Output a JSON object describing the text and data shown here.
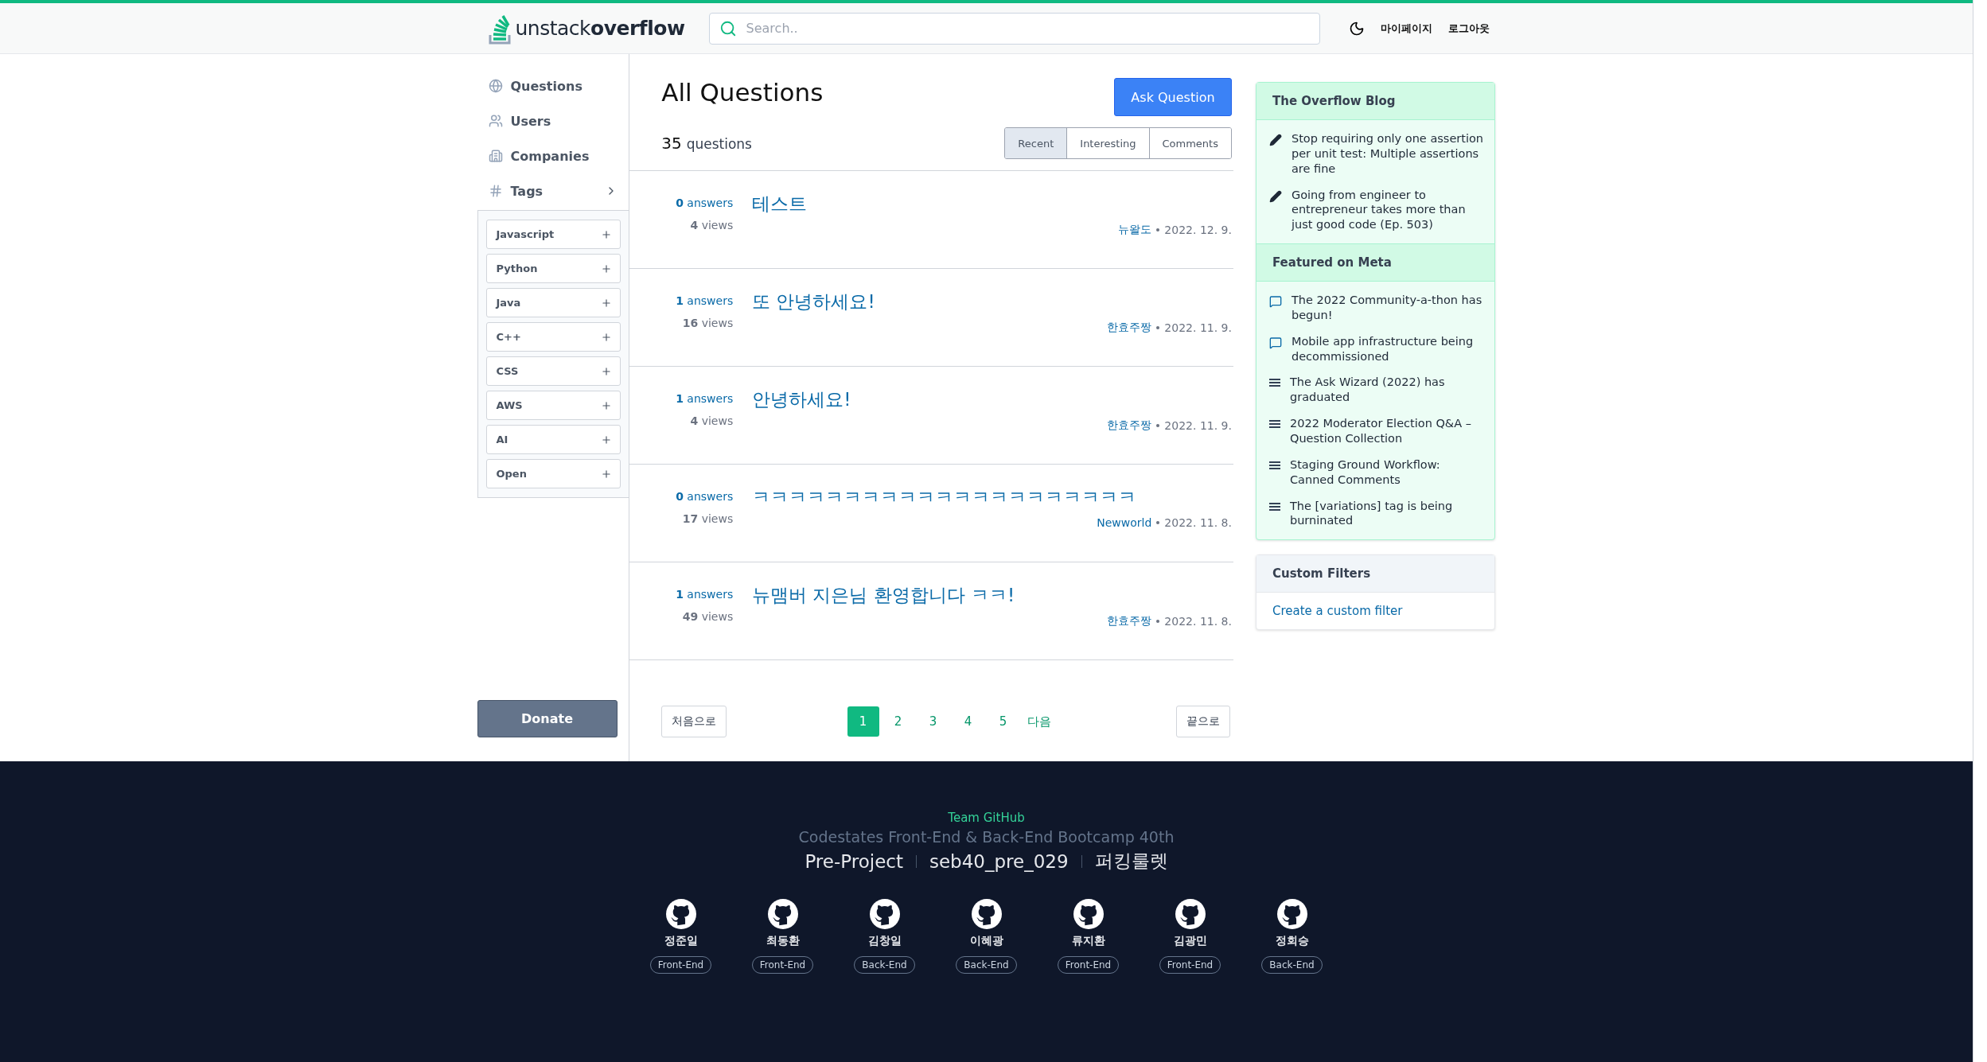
{
  "header": {
    "logo_light": "unstack",
    "logo_bold": "overflow",
    "search": {
      "placeholder": "Search.."
    },
    "links": [
      "마이페이지",
      "로그아웃"
    ]
  },
  "sidebar": {
    "items": [
      {
        "label": "Questions"
      },
      {
        "label": "Users"
      },
      {
        "label": "Companies"
      },
      {
        "label": "Tags",
        "children": [
          {
            "label": "Javascript"
          },
          {
            "label": "Python"
          },
          {
            "label": "Java"
          },
          {
            "label": "C++"
          },
          {
            "label": "CSS"
          },
          {
            "label": "AWS"
          },
          {
            "label": "AI"
          },
          {
            "label": "Open"
          }
        ]
      }
    ],
    "donate": "Donate"
  },
  "main": {
    "title": "All Questions",
    "ask_button": "Ask Question",
    "count": "35",
    "count_label": "questions",
    "tabs": [
      {
        "label": "Recent",
        "selected": true
      },
      {
        "label": "Interesting",
        "selected": false
      },
      {
        "label": "Comments",
        "selected": false
      }
    ],
    "questions": [
      {
        "answers": "0",
        "answers_label": "answers",
        "views": "4",
        "views_label": "views",
        "title": "테스트",
        "author": "뉴왈도",
        "date": "2022. 12. 9."
      },
      {
        "answers": "1",
        "answers_label": "answers",
        "views": "16",
        "views_label": "views",
        "title": "또 안녕하세요!",
        "author": "한효주짱",
        "date": "2022. 11. 9."
      },
      {
        "answers": "1",
        "answers_label": "answers",
        "views": "4",
        "views_label": "views",
        "title": "안녕하세요!",
        "author": "한효주짱",
        "date": "2022. 11. 9."
      },
      {
        "answers": "0",
        "answers_label": "answers",
        "views": "17",
        "views_label": "views",
        "title": "ㅋㅋㅋㅋㅋㅋㅋㅋㅋㅋㅋㅋㅋㅋㅋㅋㅋㅋㅋㅋㅋ",
        "author": "Newworld",
        "date": "2022. 11. 8."
      },
      {
        "answers": "1",
        "answers_label": "answers",
        "views": "49",
        "views_label": "views",
        "title": "뉴맴버 지은님 환영합니다 ㅋㅋ!",
        "author": "한효주짱",
        "date": "2022. 11. 8."
      }
    ],
    "pagination": {
      "first": "처음으로",
      "pages": [
        {
          "label": "1",
          "selected": true
        },
        {
          "label": "2",
          "selected": false
        },
        {
          "label": "3",
          "selected": false
        },
        {
          "label": "4",
          "selected": false
        },
        {
          "label": "5",
          "selected": false
        }
      ],
      "next": "다음",
      "last": "끝으로"
    }
  },
  "aside": {
    "blog": {
      "title": "The Overflow Blog",
      "items": [
        {
          "kind": "pencil",
          "text": "Stop requiring only one assertion per unit test: Multiple assertions are fine"
        },
        {
          "kind": "pencil",
          "text": "Going from engineer to entrepreneur takes more than just good code (Ep. 503)"
        }
      ]
    },
    "meta": {
      "title": "Featured on Meta",
      "items": [
        {
          "kind": "chat",
          "text": "The 2022 Community-a-thon has begun!"
        },
        {
          "kind": "chat",
          "text": "Mobile app infrastructure being decommissioned"
        },
        {
          "kind": "lines",
          "text": "The Ask Wizard (2022) has graduated"
        },
        {
          "kind": "lines",
          "text": "2022 Moderator Election Q&A – Question Collection"
        },
        {
          "kind": "lines",
          "text": "Staging Ground Workflow: Canned Comments"
        },
        {
          "kind": "lines",
          "text": "The [variations] tag is being burninated"
        }
      ]
    },
    "filters": {
      "title": "Custom Filters",
      "link": "Create a custom filter"
    }
  },
  "footer": {
    "team": "Team GitHub",
    "subtitle": "Codestates Front-End & Back-End Bootcamp 40th",
    "project": [
      "Pre-Project",
      "seb40_pre_029",
      "퍼킹룰렛"
    ],
    "members": [
      {
        "name": "정준일",
        "role": "Front-End"
      },
      {
        "name": "최동환",
        "role": "Front-End"
      },
      {
        "name": "김창일",
        "role": "Back-End"
      },
      {
        "name": "이혜광",
        "role": "Back-End"
      },
      {
        "name": "류지환",
        "role": "Front-End"
      },
      {
        "name": "김광민",
        "role": "Front-End"
      },
      {
        "name": "정회승",
        "role": "Back-End"
      }
    ]
  }
}
